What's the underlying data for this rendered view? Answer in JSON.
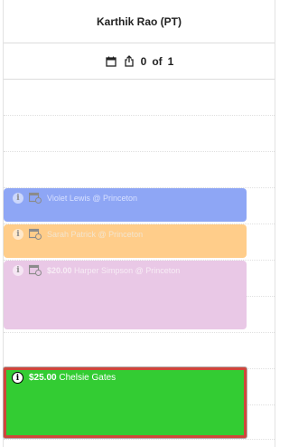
{
  "header": {
    "title": "Karthik Rao (PT)"
  },
  "toolbar": {
    "current": "0",
    "of_label": "of",
    "total": "1",
    "icons": [
      "calendar-icon",
      "share-icon"
    ]
  },
  "events": [
    {
      "price": "",
      "title": "Violet Lewis @ Princeton",
      "color": "#8ea6f5"
    },
    {
      "price": "",
      "title": "Sarah Patrick @ Princeton",
      "color": "#ffcd8a"
    },
    {
      "price": "$20.00",
      "title": "Harper Simpson @ Princeton",
      "color": "#e9c8e6"
    },
    {
      "price": "$25.00",
      "title": "Chelsie Gates",
      "color": "#33cc33"
    }
  ]
}
